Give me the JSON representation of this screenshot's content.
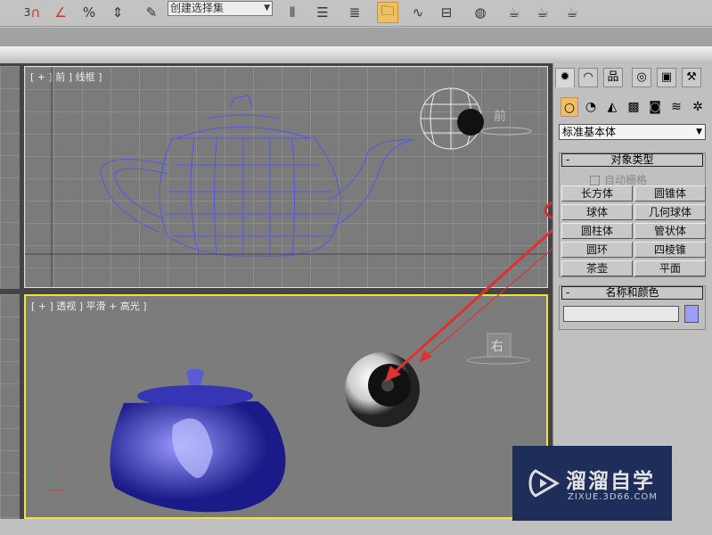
{
  "toolbar": {
    "icons": [
      "snap-3d-icon",
      "angle-snap-icon",
      "percent-snap-icon",
      "spinner-snap-icon",
      "edit-named-selection-icon",
      "mirror-icon",
      "align-icon",
      "layer-manager-icon",
      "scene-explorer-icon",
      "curve-editor-icon",
      "schematic-view-icon",
      "material-editor-icon",
      "render-setup-icon",
      "rendered-frame-icon",
      "quick-render-icon"
    ],
    "snap_label": "3",
    "selection_set": "创建选择集"
  },
  "viewports": {
    "front": {
      "label": "[ + ] 前 ] 线框 ]",
      "cube_label": "前"
    },
    "perspective": {
      "label": "[ + ] 透视 ] 平滑 + 高光 ]",
      "cube_label": "右"
    }
  },
  "panel": {
    "tabs": [
      "create-icon",
      "modify-icon",
      "hierarchy-icon",
      "motion-icon",
      "display-icon",
      "utilities-icon"
    ],
    "subtabs": [
      "geometry-icon",
      "shapes-icon",
      "lights-icon",
      "cameras-icon",
      "helpers-icon",
      "spacewarps-icon",
      "systems-icon"
    ],
    "category": "标准基本体",
    "object_type": {
      "title": "对象类型",
      "autogrid": "自动栅格",
      "buttons": [
        "长方体",
        "圆锥体",
        "球体",
        "几何球体",
        "圆柱体",
        "管状体",
        "圆环",
        "四棱锥",
        "茶壶",
        "平面"
      ]
    },
    "name_color": {
      "title": "名称和颜色",
      "name": "",
      "color": "#9aa0f8"
    }
  },
  "watermark": {
    "title": "溜溜自学",
    "url": "ZIXUE.3D66.COM"
  },
  "colors": {
    "accent": "#f0c060",
    "annotation": "#e03030",
    "wire": "#5555ee",
    "active_border": "#f0e040"
  }
}
